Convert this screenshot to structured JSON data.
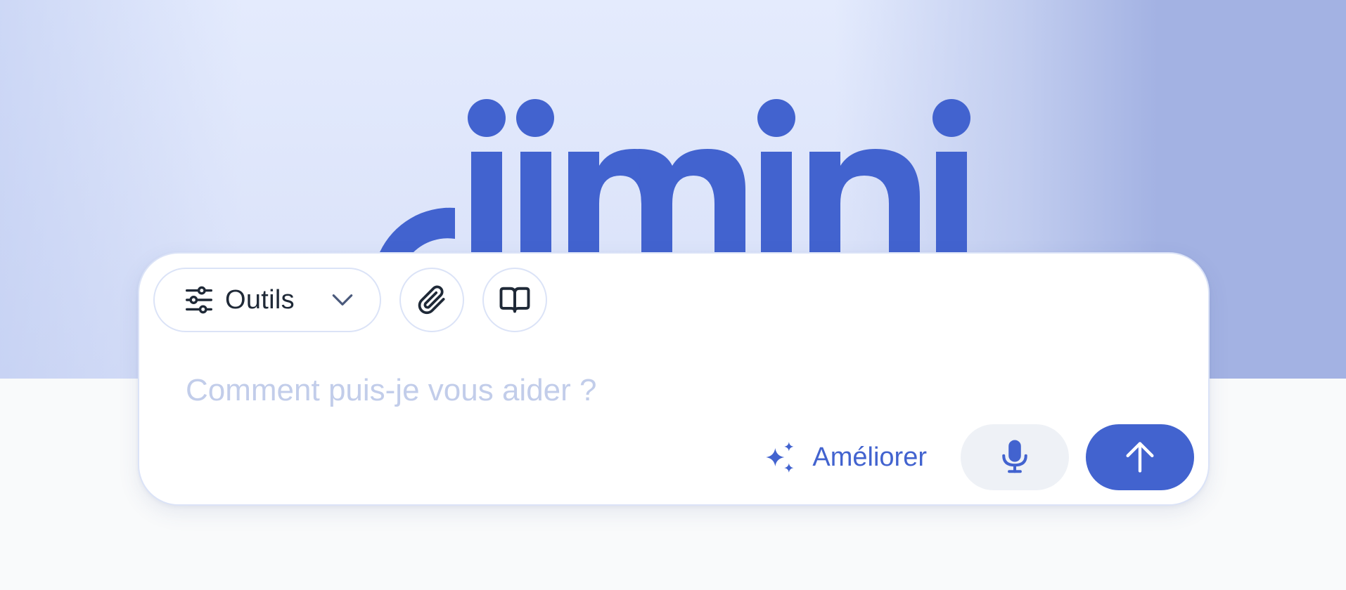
{
  "brand": {
    "logo_icon": "brand-logo",
    "logo_color": "#4263cf"
  },
  "composer": {
    "tools": {
      "label": "Outils",
      "icon": "sliders-icon",
      "chevron": "chevron-down-icon"
    },
    "attach": {
      "icon": "paperclip-icon"
    },
    "library": {
      "icon": "book-open-icon"
    },
    "input": {
      "value": "",
      "placeholder": "Comment puis-je vous aider ?"
    },
    "improve": {
      "label": "Améliorer",
      "icon": "sparkles-icon"
    },
    "mic": {
      "icon": "microphone-icon"
    },
    "send": {
      "icon": "arrow-up-icon"
    }
  },
  "colors": {
    "accent": "#4263cf",
    "hero_light": "#e4ebfd",
    "hero_dark": "#a3b2e3",
    "placeholder": "#c2cdea",
    "border": "#dbe3f7",
    "mic_bg": "#eef1f6",
    "page_bg": "#f9fafb"
  }
}
